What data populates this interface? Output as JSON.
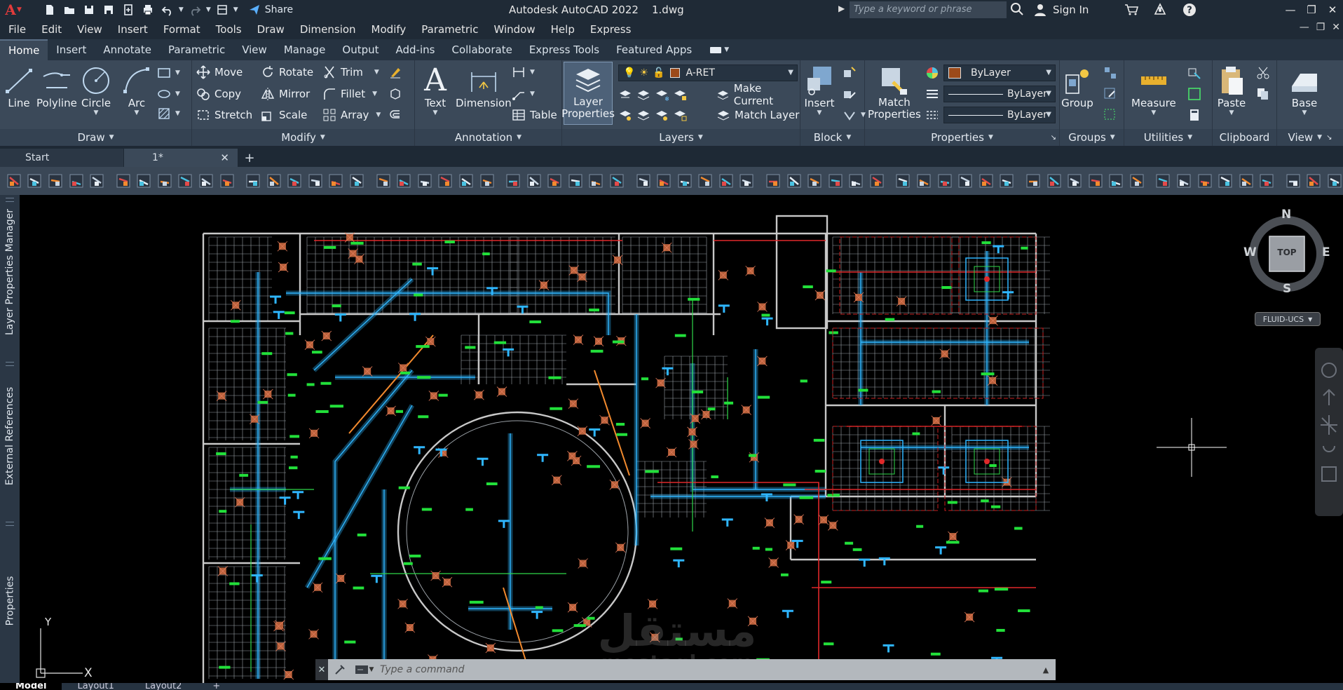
{
  "titlebar": {
    "app_name": "Autodesk AutoCAD 2022",
    "document": "1.dwg",
    "share_label": "Share",
    "search_placeholder": "Type a keyword or phrase",
    "sign_in": "Sign In"
  },
  "menu": [
    "File",
    "Edit",
    "View",
    "Insert",
    "Format",
    "Tools",
    "Draw",
    "Dimension",
    "Modify",
    "Parametric",
    "Window",
    "Help",
    "Express"
  ],
  "ribbon_tabs": [
    "Home",
    "Insert",
    "Annotate",
    "Parametric",
    "View",
    "Manage",
    "Output",
    "Add-ins",
    "Collaborate",
    "Express Tools",
    "Featured Apps"
  ],
  "ribbon": {
    "draw": {
      "title": "Draw",
      "line": "Line",
      "polyline": "Polyline",
      "circle": "Circle",
      "arc": "Arc"
    },
    "modify": {
      "title": "Modify",
      "move": "Move",
      "rotate": "Rotate",
      "trim": "Trim",
      "copy": "Copy",
      "mirror": "Mirror",
      "fillet": "Fillet",
      "stretch": "Stretch",
      "scale": "Scale",
      "array": "Array"
    },
    "annotation": {
      "title": "Annotation",
      "text": "Text",
      "dimension": "Dimension",
      "table": "Table"
    },
    "layers": {
      "title": "Layers",
      "layer_properties_1": "Layer",
      "layer_properties_2": "Properties",
      "current_layer": "A-RET",
      "make_current": "Make Current",
      "match_layer": "Match Layer"
    },
    "block": {
      "title": "Block",
      "insert": "Insert"
    },
    "properties": {
      "title": "Properties",
      "match_1": "Match",
      "match_2": "Properties",
      "color": "ByLayer",
      "linetype": "ByLayer",
      "lineweight": "ByLayer"
    },
    "groups": {
      "title": "Groups",
      "group": "Group"
    },
    "utilities": {
      "title": "Utilities",
      "measure": "Measure"
    },
    "clipboard": {
      "title": "Clipboard",
      "paste": "Paste"
    },
    "view": {
      "title": "View",
      "base": "Base"
    }
  },
  "file_tabs": {
    "start": "Start",
    "doc": "1*"
  },
  "palettes": [
    "Layer Properties Manager",
    "External References",
    "Properties"
  ],
  "viewcube": {
    "n": "N",
    "s": "S",
    "e": "E",
    "w": "W",
    "top": "TOP",
    "ucs": "FLUID-UCS"
  },
  "ucs_icon": {
    "x": "X",
    "y": "Y"
  },
  "command": {
    "placeholder": "Type a command"
  },
  "layout_tabs": [
    "Model",
    "Layout1",
    "Layout2"
  ],
  "watermark": {
    "arabic": "مستقل",
    "latin": "mostaql.com"
  },
  "colors": {
    "accent": "#5a6f86",
    "bg": "#000000",
    "ribbon": "#3b4959"
  }
}
